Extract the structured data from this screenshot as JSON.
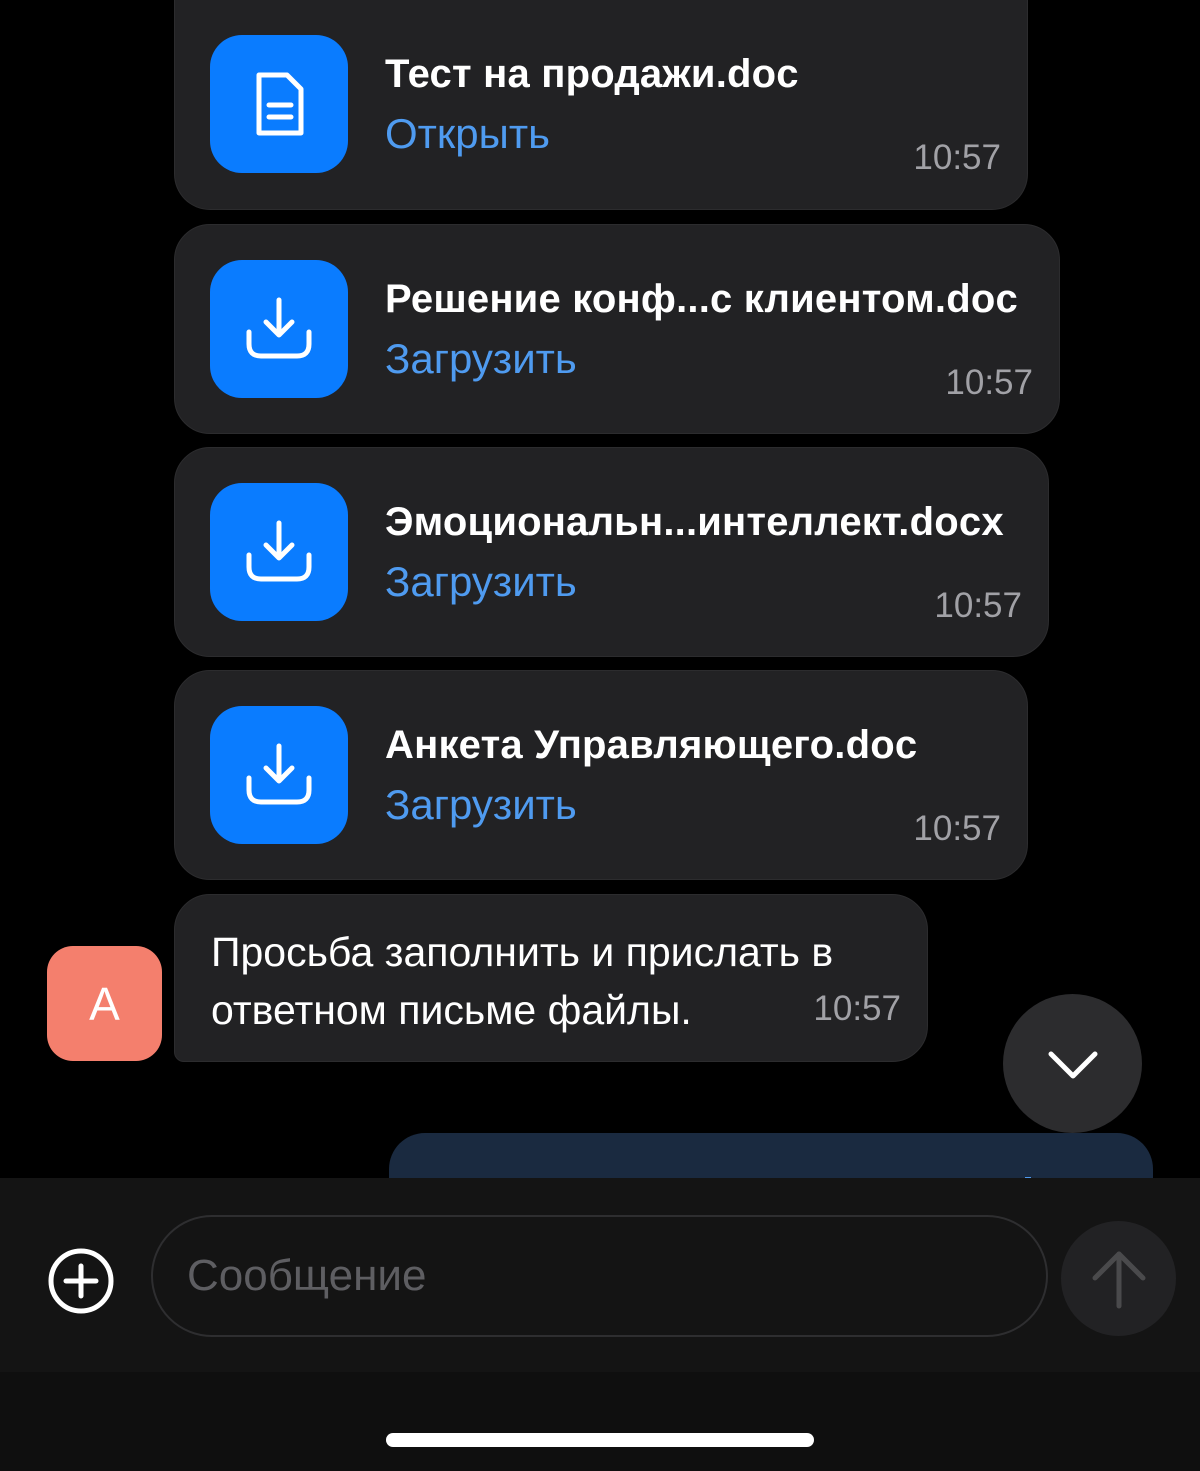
{
  "colors": {
    "background": "#000000",
    "bubble": "#222224",
    "accent": "#0a7cff",
    "link": "#4f9bf0",
    "time": "#a1a1a6",
    "avatar": "#f47f6d"
  },
  "messages": {
    "files": [
      {
        "name": "Тест на продажи.doc",
        "action": "Открыть",
        "time": "10:57",
        "icon": "document-icon"
      },
      {
        "name": "Решение конф...с клиентом.doc",
        "action": "Загрузить",
        "time": "10:57",
        "icon": "download-icon"
      },
      {
        "name": "Эмоциональн...интеллект.docx",
        "action": "Загрузить",
        "time": "10:57",
        "icon": "download-icon"
      },
      {
        "name": "Анкета Управляющего.doc",
        "action": "Загрузить",
        "time": "10:57",
        "icon": "download-icon"
      }
    ],
    "text": {
      "body": "Просьба заполнить и прислать в ответном письме файлы.",
      "time": "10:57",
      "avatar_letter": "A"
    }
  },
  "composer": {
    "placeholder": "Сообщение",
    "add_icon": "plus-circle-icon",
    "send_icon": "arrow-up-icon"
  },
  "scroll_button_icon": "chevron-down-icon"
}
